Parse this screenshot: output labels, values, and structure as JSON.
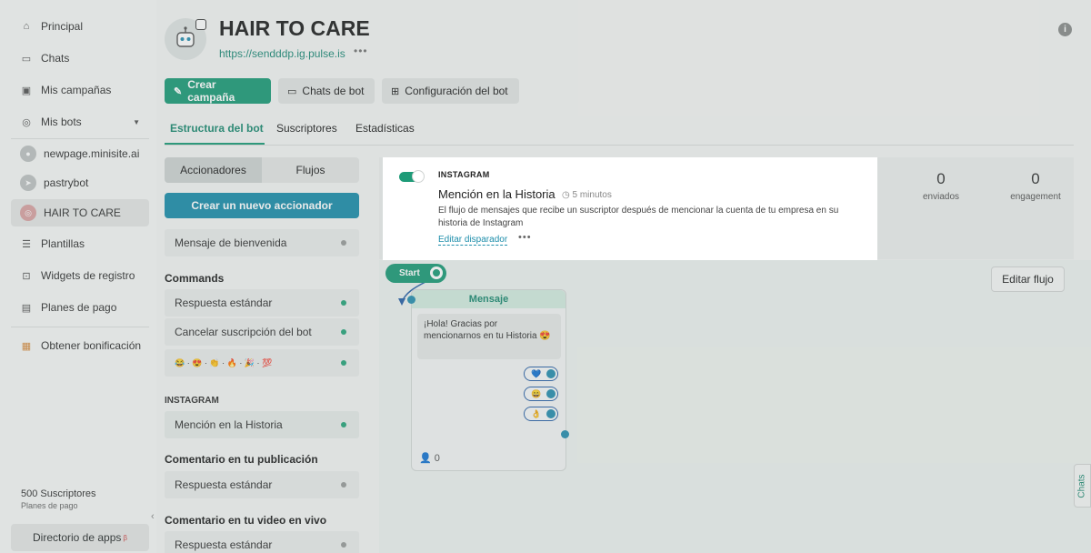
{
  "sidebar": {
    "items": [
      {
        "label": "Principal",
        "icon": "home-icon"
      },
      {
        "label": "Chats",
        "icon": "chat-icon"
      },
      {
        "label": "Mis campañas",
        "icon": "campaign-icon"
      },
      {
        "label": "Mis bots",
        "icon": "bot-icon"
      },
      {
        "label": "newpage.minisite.ai",
        "icon": "minisite-avatar"
      },
      {
        "label": "pastrybot",
        "icon": "telegram-avatar"
      },
      {
        "label": "HAIR TO CARE",
        "icon": "instagram-avatar"
      },
      {
        "label": "Plantillas",
        "icon": "templates-icon"
      },
      {
        "label": "Widgets de registro",
        "icon": "widgets-icon"
      },
      {
        "label": "Planes de pago",
        "icon": "billing-icon"
      },
      {
        "label": "Obtener bonificación",
        "icon": "gift-icon"
      }
    ],
    "subscribers": "500 Suscriptores",
    "plan": "Planes de pago",
    "apps_label": "Directorio de apps",
    "apps_badge": "β"
  },
  "header": {
    "title": "HAIR TO CARE",
    "url": "https://sendddp.ig.pulse.is",
    "more": "•••"
  },
  "actions": {
    "create_campaign": "Crear campaña",
    "bot_chats": "Chats de bot",
    "bot_settings": "Configuración del bot"
  },
  "tabs": [
    "Estructura del bot",
    "Suscriptores",
    "Estadísticas"
  ],
  "triggers_panel": {
    "segments": [
      "Accionadores",
      "Flujos"
    ],
    "new_trigger": "Crear un nuevo accionador",
    "welcome": "Mensaje de bienvenida",
    "commands_title": "Commands",
    "commands": [
      "Respuesta estándar",
      "Cancelar suscripción del bot",
      "😂 · 😍 · 👏 · 🔥 · 🎉 · 💯"
    ],
    "instagram_title": "INSTAGRAM",
    "instagram_item": "Mención en la Historia",
    "comment_post_title": "Comentario en tu publicación",
    "comment_post_item": "Respuesta estándar",
    "comment_live_title": "Comentario en tu video en vivo",
    "comment_live_item": "Respuesta estándar"
  },
  "stats": {
    "sent_value": "0",
    "sent_label": "enviados",
    "engagement_value": "0",
    "engagement_label": "engagement"
  },
  "highlight": {
    "channel": "INSTAGRAM",
    "title": "Mención en la Historia",
    "time": "5 minutos",
    "description": "El flujo de mensajes que recibe un suscriptor después de mencionar la cuenta de tu empresa en su historia de Instagram",
    "edit_link": "Editar disparador",
    "more": "•••"
  },
  "canvas": {
    "start": "Start",
    "edit_flow": "Editar flujo",
    "chats_tab": "Chats",
    "node_title": "Mensaje",
    "node_text": "¡Hola! Gracias por mencionarnos en tu Historia 😍",
    "quick_replies": [
      "💙",
      "😄",
      "👌"
    ],
    "node_count": "0"
  },
  "colors": {
    "accent": "#1e9b78",
    "link": "#1e8eab"
  }
}
